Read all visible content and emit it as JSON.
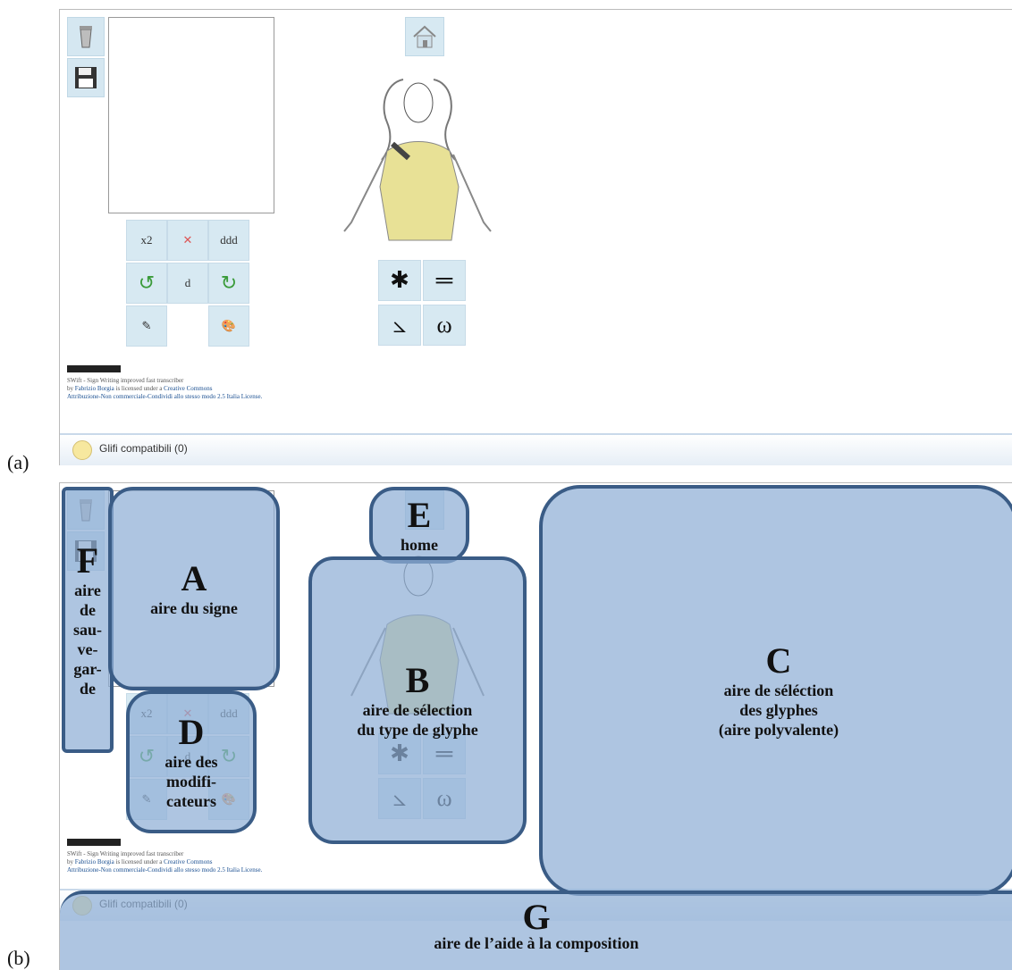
{
  "labels": {
    "a": "(a)",
    "b": "(b)"
  },
  "app": {
    "license": {
      "line1": "SWift - Sign Writing improved fast transcriber",
      "line2_prefix": "by",
      "author": "Fabrizio Borgia",
      "line2_mid": "is licensed under a",
      "cc_link": "Creative Commons",
      "line3": "Attribuzione-Non commerciale-Condividi allo stesso modo 2.5 Italia License."
    },
    "footer": {
      "text": "Glifi compatibili (0)"
    },
    "modifiers": [
      "x2",
      "✕",
      "ddd",
      "↺",
      "d",
      "↻",
      "✎",
      "",
      "🎨"
    ],
    "types": [
      "✱",
      "═",
      "⦣",
      "ω"
    ]
  },
  "regions": {
    "a": {
      "letter": "A",
      "text": "aire du signe"
    },
    "b": {
      "letter": "B",
      "line1": "aire de sélection",
      "line2": "du type de glyphe"
    },
    "c": {
      "letter": "C",
      "line1": "aire de séléction",
      "line2": "des glyphes",
      "line3": "(aire polyvalente)"
    },
    "d": {
      "letter": "D",
      "line1": "aire des",
      "line2": "modifi-",
      "line3": "cateurs"
    },
    "e": {
      "letter": "E",
      "text": "home"
    },
    "f": {
      "letter": "F",
      "l1": "aire",
      "l2": "de",
      "l3": "sau-",
      "l4": "ve-",
      "l5": "gar-",
      "l6": "de"
    },
    "g": {
      "letter": "G",
      "text": "aire de l’aide à la composition"
    }
  }
}
